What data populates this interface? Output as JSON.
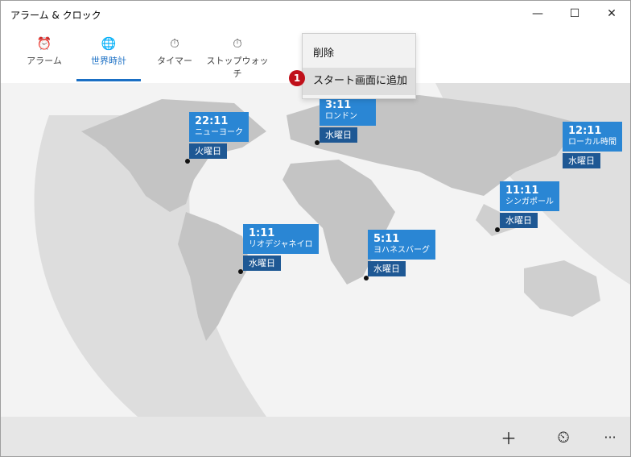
{
  "window": {
    "title": "アラーム & クロック",
    "minimize": "—",
    "maximize": "☐",
    "close": "✕"
  },
  "tabs": [
    {
      "label": "アラーム",
      "icon": "⏰"
    },
    {
      "label": "世界時計",
      "icon": "🌐"
    },
    {
      "label": "タイマー",
      "icon": "⏱"
    },
    {
      "label": "ストップウォッチ",
      "icon": "⏱"
    }
  ],
  "context_menu": {
    "items": [
      "削除",
      "スタート画面に追加"
    ],
    "annotation_number": "1"
  },
  "clocks": [
    {
      "time": "22:11",
      "city": "ニューヨーク",
      "day": "火曜日"
    },
    {
      "time": "3:11",
      "city": "ロンドン",
      "day": "水曜日"
    },
    {
      "time": "12:11",
      "city": "ローカル時間",
      "day": "水曜日"
    },
    {
      "time": "11:11",
      "city": "シンガポール",
      "day": "水曜日"
    },
    {
      "time": "1:11",
      "city": "リオデジャネイロ",
      "day": "水曜日"
    },
    {
      "time": "5:11",
      "city": "ヨハネスバーグ",
      "day": "水曜日"
    }
  ],
  "bottom_bar": {
    "add": "＋",
    "compare": "⏲",
    "more": "···"
  },
  "colors": {
    "accent": "#1a6fc4",
    "card_top": "#2a86d4",
    "card_day": "#1e5894",
    "marker": "#c0101a"
  }
}
